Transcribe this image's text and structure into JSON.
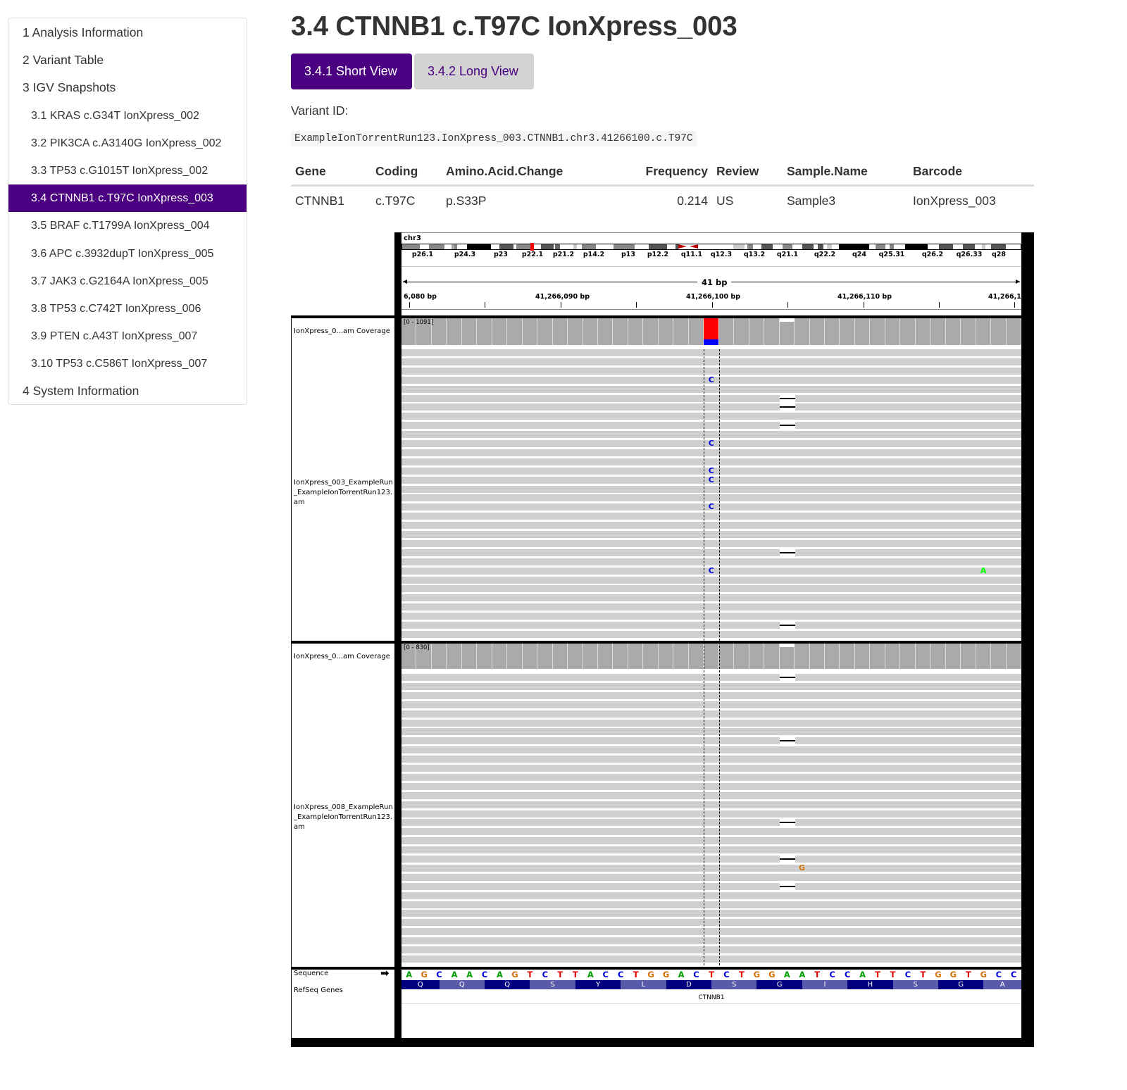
{
  "toc": {
    "items": [
      {
        "label": "1 Analysis Information",
        "level": 1,
        "active": false
      },
      {
        "label": "2 Variant Table",
        "level": 1,
        "active": false
      },
      {
        "label": "3 IGV Snapshots",
        "level": 1,
        "active": false
      },
      {
        "label": "3.1 KRAS c.G34T IonXpress_002",
        "level": 2,
        "active": false
      },
      {
        "label": "3.2 PIK3CA c.A3140G IonXpress_002",
        "level": 2,
        "active": false
      },
      {
        "label": "3.3 TP53 c.G1015T IonXpress_002",
        "level": 2,
        "active": false
      },
      {
        "label": "3.4 CTNNB1 c.T97C IonXpress_003",
        "level": 2,
        "active": true
      },
      {
        "label": "3.5 BRAF c.T1799A IonXpress_004",
        "level": 2,
        "active": false
      },
      {
        "label": "3.6 APC c.3932dupT IonXpress_005",
        "level": 2,
        "active": false
      },
      {
        "label": "3.7 JAK3 c.G2164A IonXpress_005",
        "level": 2,
        "active": false
      },
      {
        "label": "3.8 TP53 c.C742T IonXpress_006",
        "level": 2,
        "active": false
      },
      {
        "label": "3.9 PTEN c.A43T IonXpress_007",
        "level": 2,
        "active": false
      },
      {
        "label": "3.10 TP53 c.C586T IonXpress_007",
        "level": 2,
        "active": false
      },
      {
        "label": "4 System Information",
        "level": 1,
        "active": false
      }
    ]
  },
  "page": {
    "title": "3.4 CTNNB1 c.T97C IonXpress_003",
    "tabs": [
      {
        "label": "3.4.1 Short View",
        "active": true
      },
      {
        "label": "3.4.2 Long View",
        "active": false
      }
    ],
    "variant_id_label": "Variant ID:",
    "variant_id": "ExampleIonTorrentRun123.IonXpress_003.CTNNB1.chr3.41266100.c.T97C"
  },
  "variant_table": {
    "headers": [
      "Gene",
      "Coding",
      "Amino.Acid.Change",
      "Frequency",
      "Review",
      "Sample.Name",
      "Barcode"
    ],
    "rows": [
      [
        "CTNNB1",
        "c.T97C",
        "p.S33P",
        "0.214",
        "US",
        "Sample3",
        "IonXpress_003"
      ]
    ]
  },
  "igv": {
    "chromosome": "chr3",
    "cytobands": [
      "p26.1",
      "p24.3",
      "p23",
      "p22.1",
      "p21.2",
      "p14.2",
      "p13",
      "p12.2",
      "q11.1",
      "q12.3",
      "q13.2",
      "q21.1",
      "q22.2",
      "q24",
      "q25.31",
      "q26.2",
      "q26.33",
      "q28"
    ],
    "span_label": "41 bp",
    "ruler_ticks": [
      "6,080 bp",
      "41,266,090 bp",
      "41,266,100 bp",
      "41,266,110 bp",
      "41,266,1"
    ],
    "view_start_bp": 41266079.5,
    "view_bp": 41,
    "variant_bp": 41266100,
    "tracks": [
      {
        "coverage_name": "IonXpress_0...am Coverage",
        "coverage_range": "[0 - 1091]",
        "alignment_name": "IonXpress_003_ExampleRun_ExampleIonTorrentRun123.bam",
        "alignment_name_display": "IonXpress_003_ExampleRun\n_ExampleIonTorrentRun123.\nam",
        "variant_allele_fraction": 0.214,
        "mismatches": [
          {
            "row": 3,
            "pos": 20,
            "base": "C"
          },
          {
            "row": 10,
            "pos": 20,
            "base": "C"
          },
          {
            "row": 13,
            "pos": 20,
            "base": "C"
          },
          {
            "row": 14,
            "pos": 20,
            "base": "C"
          },
          {
            "row": 17,
            "pos": 20,
            "base": "C"
          },
          {
            "row": 24,
            "pos": 20,
            "base": "C"
          },
          {
            "row": 24,
            "pos": 38,
            "base": "A"
          }
        ],
        "deletions": [
          {
            "row": 5,
            "pos": 25
          },
          {
            "row": 6,
            "pos": 25
          },
          {
            "row": 8,
            "pos": 25
          },
          {
            "row": 22,
            "pos": 25
          },
          {
            "row": 30,
            "pos": 25
          }
        ]
      },
      {
        "coverage_name": "IonXpress_0...am Coverage",
        "coverage_range": "[0 - 830]",
        "alignment_name": "IonXpress_008_ExampleRun_ExampleIonTorrentRun123.bam",
        "alignment_name_display": "IonXpress_008_ExampleRun\n_ExampleIonTorrentRun123.\nam",
        "variant_allele_fraction": 0,
        "mismatches": [
          {
            "row": 21,
            "pos": 26,
            "base": "G"
          }
        ],
        "deletions": [
          {
            "row": 0,
            "pos": 25
          },
          {
            "row": 7,
            "pos": 25
          },
          {
            "row": 16,
            "pos": 25
          },
          {
            "row": 20,
            "pos": 25
          },
          {
            "row": 23,
            "pos": 25
          }
        ]
      }
    ],
    "sequence_label": "Sequence",
    "sequence_strand_icon": "arrow-right",
    "sequence": "AGCAACAGTCTTACCTGGACTCTGGAATCCATTCTGGTGCC",
    "refseq_label": "RefSeq Genes",
    "amino_acids": [
      "Q",
      "Q",
      "Q",
      "S",
      "Y",
      "L",
      "D",
      "S",
      "G",
      "I",
      "H",
      "S",
      "G",
      "A"
    ],
    "gene_name": "CTNNB1",
    "base_colors": {
      "A": "#00a000",
      "C": "#0000e0",
      "G": "#d17105",
      "T": "#e00000"
    }
  }
}
